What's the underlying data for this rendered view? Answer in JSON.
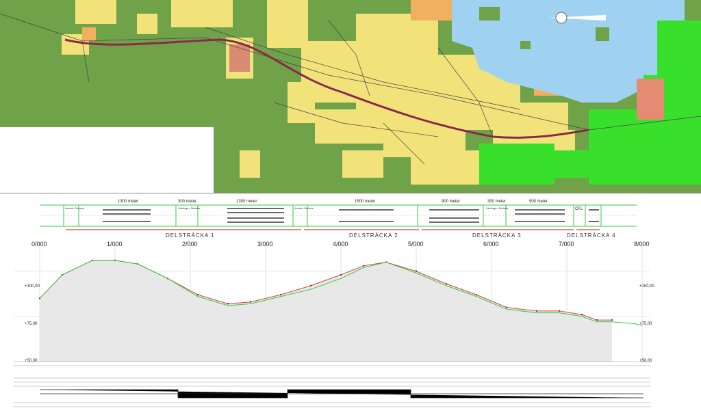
{
  "sections": [
    {
      "label": "DELSTRÄCKA 1"
    },
    {
      "label": "DELSTRÄCKA 2"
    },
    {
      "label": "DELSTRÄCKA 3"
    },
    {
      "label": "DELSTRÄCKA 4"
    }
  ],
  "distances": [
    "1300 meter",
    "300 meter",
    "1300 meter",
    "1500 meter",
    "900 meter",
    "300 meter",
    "900 meter"
  ],
  "zone_labels": {
    "avslut": "Avslut= Sträcka",
    "vaxlings": "Växlings= Sträcka",
    "cfl": "CFL"
  },
  "km_ticks": [
    "0/000",
    "1/000",
    "2/000",
    "3/000",
    "4/000",
    "5/000",
    "6/000",
    "7/000",
    "8/000"
  ],
  "elevation_labels": [
    "+100,00",
    "+75,00",
    "+50,00"
  ],
  "colors": {
    "road": "#8a2a4a",
    "lake": "#9fd2f0",
    "urban": "#f2e27a",
    "forest": "#6fa249",
    "bright": "#39e02b",
    "section_line": "#e53e3e",
    "green_line": "#2ecc40"
  },
  "chart_data": {
    "type": "line",
    "title": "",
    "xlabel": "",
    "ylabel": "",
    "xlim": [
      0,
      8000
    ],
    "ylim": [
      50,
      112
    ],
    "series": [
      {
        "x": [
          0,
          300,
          700,
          1000,
          1300,
          1700,
          2100,
          2500,
          2800,
          3200,
          3600,
          4000,
          4300,
          4600,
          5000,
          5400,
          5800,
          6200,
          6600,
          6900,
          7200,
          7400,
          7600
        ],
        "values": [
          85,
          98,
          106,
          106,
          104,
          96,
          87,
          82,
          83,
          87,
          92,
          98,
          103,
          105,
          100,
          93,
          87,
          80,
          78,
          78,
          76,
          73,
          73
        ]
      },
      {
        "x": [
          0,
          300,
          700,
          1000,
          1300,
          1700,
          2100,
          2500,
          2800,
          3200,
          3600,
          4000,
          4300,
          4600,
          5000,
          5400,
          5800,
          6200,
          6600,
          6900,
          7200,
          7400,
          7600,
          7900,
          8000
        ],
        "values": [
          85,
          98,
          106,
          106,
          104,
          96,
          86,
          81,
          82,
          86,
          90,
          96,
          102,
          105,
          99,
          92,
          86,
          79,
          77,
          77,
          75,
          72,
          72,
          71,
          70
        ]
      }
    ]
  }
}
